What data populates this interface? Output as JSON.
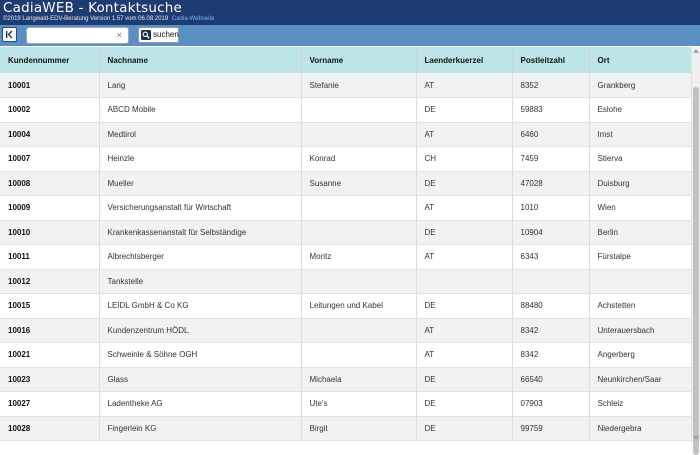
{
  "app": {
    "title": "CadiaWEB - Kontaktsuche",
    "subtitle": "©2019 Langwald-EDV-Beratung Version 1.57 vom 06.08.2019",
    "website_link": "Cadia-Webseite"
  },
  "toolbar": {
    "first_icon": "first-page-icon",
    "search_value": "",
    "search_placeholder": "",
    "clear_icon": "×",
    "search_label": "suchen",
    "search_icon": "search-icon"
  },
  "table": {
    "columns": [
      "Kundennummer",
      "Nachname",
      "Vorname",
      "Laenderkuerzel",
      "Postleitzahl",
      "Ort"
    ],
    "rows": [
      [
        "10001",
        "Lang",
        "Stefanie",
        "AT",
        "8352",
        "Grankberg"
      ],
      [
        "10002",
        "ABCD Mobile",
        "",
        "DE",
        "59883",
        "Eslohe"
      ],
      [
        "10004",
        "Medtirol",
        "",
        "AT",
        "6460",
        "Imst"
      ],
      [
        "10007",
        "Heinzle",
        "Konrad",
        "CH",
        "7459",
        "Stierva"
      ],
      [
        "10008",
        "Mueller",
        "Susanne",
        "DE",
        "47028",
        "Duisburg"
      ],
      [
        "10009",
        "Versicherungsanstalt für Wirtschaft",
        "",
        "AT",
        "1010",
        "Wien"
      ],
      [
        "10010",
        "Krankenkassenanstalt für Selbständige",
        "",
        "DE",
        "10904",
        "Berlin"
      ],
      [
        "10011",
        "Albrechtsberger",
        "Moritz",
        "AT",
        "6343",
        "Fürstalpe"
      ],
      [
        "10012",
        "Tankstelle",
        "",
        "",
        "",
        ""
      ],
      [
        "10015",
        "LEIDL GmbH & Co KG",
        "Leitungen und Kabel",
        "DE",
        "88480",
        "Achstetten"
      ],
      [
        "10016",
        "Kundenzentrum HÖDL",
        "",
        "AT",
        "8342",
        "Unterauersbach"
      ],
      [
        "10021",
        "Schweinle & Söhne OGH",
        "",
        "AT",
        "8342",
        "Angerberg"
      ],
      [
        "10023",
        "Glass",
        "Michaela",
        "DE",
        "66540",
        "Neunkirchen/Saar"
      ],
      [
        "10027",
        "Ladentheke AG",
        "Ute's",
        "DE",
        "07903",
        "Schleiz"
      ],
      [
        "10028",
        "Fingerlein KG",
        "Birgit",
        "DE",
        "99759",
        "Niedergebra"
      ]
    ]
  },
  "colors": {
    "titlebar": "#1f3b73",
    "toolbar": "#5a8fc4",
    "header_row": "#bde4e6",
    "row_alt": "#f2f2f2"
  }
}
